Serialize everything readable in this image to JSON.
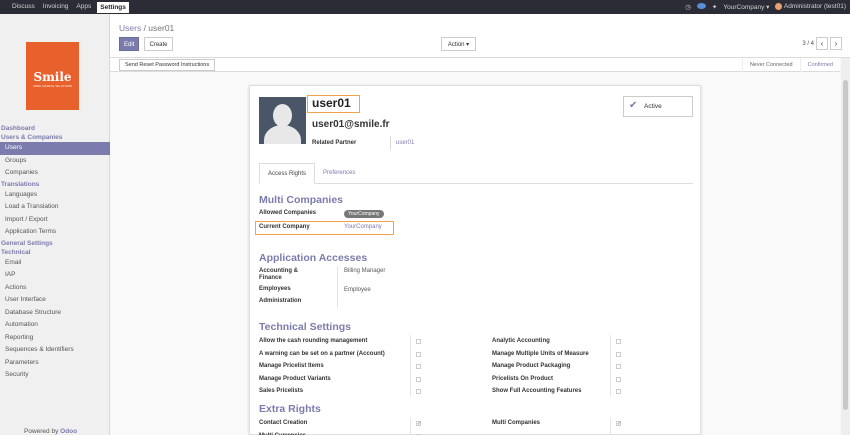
{
  "topbar": {
    "menu": [
      "Discuss",
      "Invoicing",
      "Apps",
      "Settings"
    ],
    "active_menu": "Settings",
    "company": "YourCompany ▾",
    "user": "Administrator (test01)"
  },
  "sidebar": {
    "logo_title": "Smile",
    "logo_subtitle": "OPEN SOURCE SOLUTIONS",
    "nav": [
      {
        "type": "sec",
        "label": "Dashboard"
      },
      {
        "type": "sec",
        "label": "Users & Companies"
      },
      {
        "type": "item",
        "label": "Users",
        "active": true
      },
      {
        "type": "item",
        "label": "Groups"
      },
      {
        "type": "item",
        "label": "Companies"
      },
      {
        "type": "sec",
        "label": "Translations"
      },
      {
        "type": "item",
        "label": "Languages"
      },
      {
        "type": "item",
        "label": "Load a Translation"
      },
      {
        "type": "item",
        "label": "Import / Export"
      },
      {
        "type": "item",
        "label": "Application Terms"
      },
      {
        "type": "sec",
        "label": "General Settings"
      },
      {
        "type": "sec",
        "label": "Technical"
      },
      {
        "type": "item",
        "label": "Email"
      },
      {
        "type": "item",
        "label": "IAP"
      },
      {
        "type": "item",
        "label": "Actions"
      },
      {
        "type": "item",
        "label": "User Interface"
      },
      {
        "type": "item",
        "label": "Database Structure"
      },
      {
        "type": "item",
        "label": "Automation"
      },
      {
        "type": "item",
        "label": "Reporting"
      },
      {
        "type": "item",
        "label": "Sequences & Identifiers"
      },
      {
        "type": "item",
        "label": "Parameters"
      },
      {
        "type": "item",
        "label": "Security"
      }
    ],
    "powered_prefix": "Powered by",
    "powered_brand": "Odoo"
  },
  "controlpanel": {
    "breadcrumb_parent": "Users",
    "breadcrumb_sep": " / ",
    "breadcrumb_current": "user01",
    "edit": "Edit",
    "create": "Create",
    "action": "Action ▾",
    "pager": "3 / 4",
    "prev": "‹",
    "next": "›"
  },
  "statusbar": {
    "reset_btn": "Send Reset Password Instructions",
    "steps": [
      "Never Connected",
      "Confirmed"
    ],
    "current": "Confirmed"
  },
  "form": {
    "name": "user01",
    "email": "user01@smile.fr",
    "related_partner_label": "Related Partner",
    "related_partner_value": "user01",
    "active_label": "Active",
    "tabs": [
      "Access Rights",
      "Preferences"
    ],
    "multi_companies_title": "Multi Companies",
    "allowed_companies_label": "Allowed Companies",
    "allowed_companies_value": "YourCompany",
    "current_company_label": "Current Company",
    "current_company_value": "YourCompany",
    "app_access_title": "Application Accesses",
    "accounting_label": "Accounting & Finance",
    "accounting_value": "Billing Manager",
    "employees_label": "Employees",
    "employees_value": "Employee",
    "administration_label": "Administration",
    "tech_title": "Technical Settings",
    "tech_left": [
      {
        "label": "Allow the cash rounding management",
        "checked": false
      },
      {
        "label": "A warning can be set on a partner (Account)",
        "checked": false
      },
      {
        "label": "Manage Pricelist Items",
        "checked": false
      },
      {
        "label": "Manage Product Variants",
        "checked": false
      },
      {
        "label": "Sales Pricelists",
        "checked": false
      }
    ],
    "tech_right": [
      {
        "label": "Analytic Accounting",
        "checked": false
      },
      {
        "label": "Manage Multiple Units of Measure",
        "checked": false
      },
      {
        "label": "Manage Product Packaging",
        "checked": false
      },
      {
        "label": "Pricelists On Product",
        "checked": false
      },
      {
        "label": "Show Full Accounting Features",
        "checked": false
      }
    ],
    "extra_title": "Extra Rights",
    "extra_left": [
      {
        "label": "Contact Creation",
        "checked": true
      },
      {
        "label": "Multi Currencies",
        "checked": false
      }
    ],
    "extra_right": [
      {
        "label": "Multi Companies",
        "checked": true
      }
    ]
  },
  "colors": {
    "accent": "#7c7bad",
    "highlight": "#f2a24a",
    "navbar": "#2c2c36"
  }
}
